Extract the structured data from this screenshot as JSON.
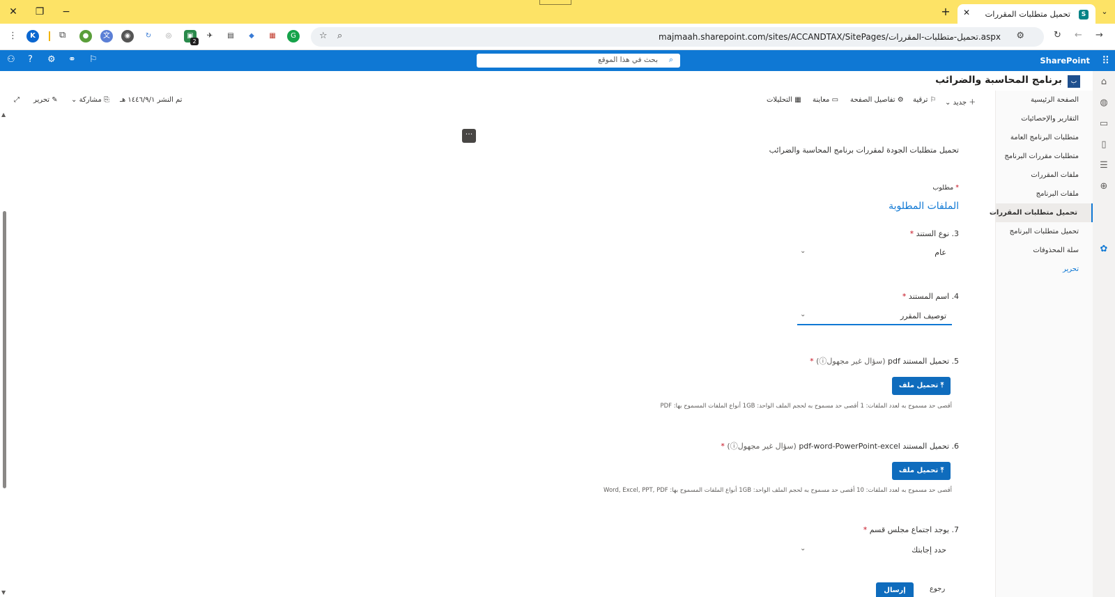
{
  "browser": {
    "tab_title": "تحميل متطلبات المقررات",
    "tab_favicon": "S",
    "url": "majmaah.sharepoint.com/sites/ACCANDTAX/SitePages/تحميل-متطلبات-المقررات.aspx",
    "extension_badge": "2",
    "profile_initial": "K"
  },
  "suite": {
    "brand": "SharePoint",
    "search_placeholder": "بحث في هذا الموقع"
  },
  "site": {
    "logo_text": "ب",
    "title": "برنامج المحاسبة والضرائب"
  },
  "nav": {
    "items": [
      {
        "label": "الصفحة الرئيسية"
      },
      {
        "label": "التقارير والإحصائيات"
      },
      {
        "label": "متطلبات البرنامج العامة"
      },
      {
        "label": "متطلبات مقررات البرنامج"
      },
      {
        "label": "ملفات المقررات"
      },
      {
        "label": "ملفات البرنامج"
      },
      {
        "label": "تحميل متطلبات المقررات"
      },
      {
        "label": "تحميل متطلبات البرنامج"
      },
      {
        "label": "سلة المحذوفات"
      },
      {
        "label": "تحرير"
      }
    ]
  },
  "command_bar": {
    "new": "جديد",
    "promote": "ترقية",
    "page_details": "تفاصيل الصفحة",
    "preview": "معاينة",
    "analytics": "التحليلات",
    "published": "تم النشر ١٤٤٦/٩/١ هـ",
    "share": "مشاركة",
    "edit": "تحرير"
  },
  "form": {
    "intro": "تحميل متطلبات الجودة  لمقررات برنامج المحاسبة والضرائب",
    "required_note": "مطلوب",
    "section_title": "الملفات المطلوبة",
    "q3": {
      "label": "3. نوع الستند",
      "value": "عام"
    },
    "q4": {
      "label": "4. اسم المستند",
      "value": "توصيف المقرر"
    },
    "q5": {
      "label": "5. تحميل المستند pdf",
      "anon": "(سؤال غير مجهول",
      "button": "تحميل ملف",
      "hint": "أقصى حد مسموح به لعدد الملفات: 1  أقصى حد مسموح به لحجم الملف الواحد: 1GB  أنواع الملفات المسموح بها: PDF"
    },
    "q6": {
      "label": "6. تحميل المستند pdf-word-PowerPoint-excel",
      "anon": "(سؤال غير مجهول",
      "button": "تحميل ملف",
      "hint": "أقصى حد مسموح به لعدد الملفات: 10  أقصى حد مسموح به لحجم الملف الواحد: 1GB  أنواع الملفات المسموح بها: Word, Excel, PPT, PDF"
    },
    "q7": {
      "label": "7. يوجد اجتماع مجلس قسم",
      "value": "حدد إجابتك"
    },
    "submit": "إرسال",
    "back": "رجوع",
    "more": "···"
  },
  "colors": {
    "tabstrip": "#fde366",
    "suitebar": "#0f78d4",
    "primary_button": "#0f6cbd"
  }
}
